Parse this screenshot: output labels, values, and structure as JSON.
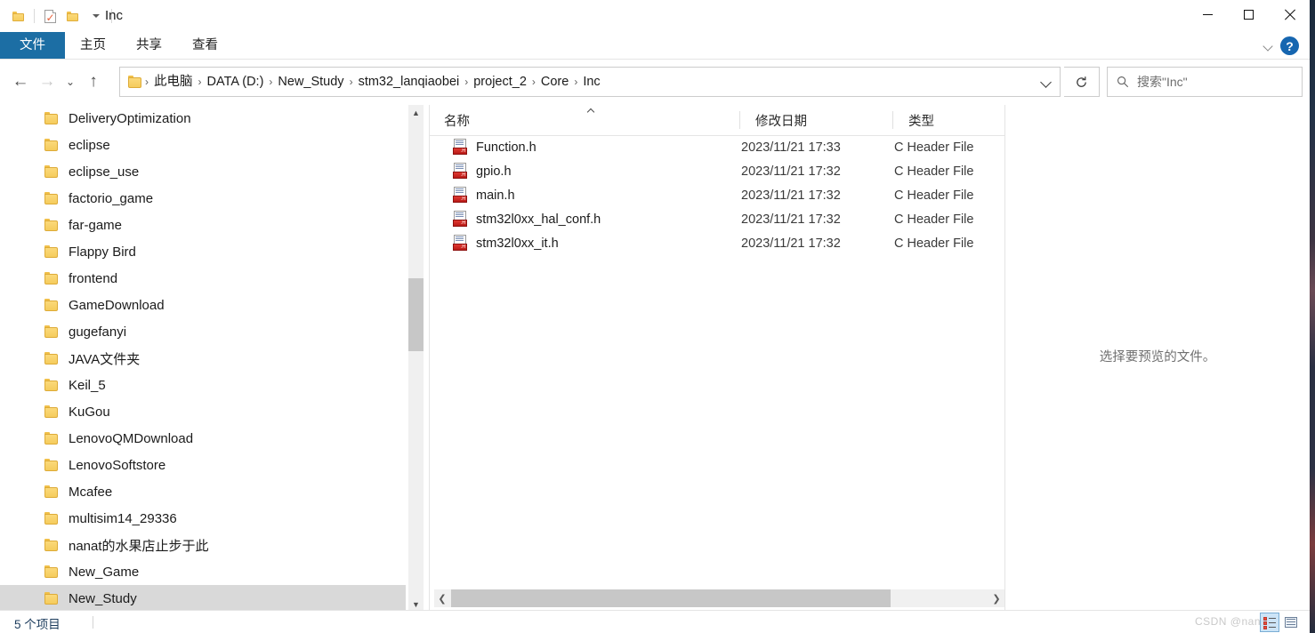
{
  "window": {
    "title": "Inc",
    "quick_access": [
      {
        "name": "folder-icon",
        "label": ""
      },
      {
        "name": "properties-icon",
        "label": ""
      },
      {
        "name": "new-folder-icon",
        "label": ""
      },
      {
        "name": "customize-dropdown-icon",
        "label": ""
      }
    ],
    "controls": {
      "minimize": "minimize-button",
      "maximize": "maximize-button",
      "close": "close-button"
    }
  },
  "ribbon": {
    "tabs": [
      {
        "label": "文件",
        "active": true
      },
      {
        "label": "主页",
        "active": false
      },
      {
        "label": "共享",
        "active": false
      },
      {
        "label": "查看",
        "active": false
      }
    ],
    "collapse_label": "",
    "help_label": "?"
  },
  "addressbar": {
    "back": "←",
    "forward": "→",
    "recent": "⌄",
    "up": "↑",
    "crumbs": [
      "此电脑",
      "DATA (D:)",
      "New_Study",
      "stm32_lanqiaobei",
      "project_2",
      "Core",
      "Inc"
    ],
    "separator": "›",
    "refresh_label": "刷新",
    "search_placeholder": "搜索\"Inc\""
  },
  "navpane": {
    "items": [
      {
        "label": "DeliveryOptimization",
        "selected": false
      },
      {
        "label": "eclipse",
        "selected": false
      },
      {
        "label": "eclipse_use",
        "selected": false
      },
      {
        "label": "factorio_game",
        "selected": false
      },
      {
        "label": "far-game",
        "selected": false
      },
      {
        "label": "Flappy Bird",
        "selected": false
      },
      {
        "label": "frontend",
        "selected": false
      },
      {
        "label": "GameDownload",
        "selected": false
      },
      {
        "label": "gugefanyi",
        "selected": false
      },
      {
        "label": "JAVA文件夹",
        "selected": false
      },
      {
        "label": "Keil_5",
        "selected": false
      },
      {
        "label": "KuGou",
        "selected": false
      },
      {
        "label": "LenovoQMDownload",
        "selected": false
      },
      {
        "label": "LenovoSoftstore",
        "selected": false
      },
      {
        "label": "Mcafee",
        "selected": false
      },
      {
        "label": "multisim14_29336",
        "selected": false
      },
      {
        "label": "nanat的水果店止步于此",
        "selected": false
      },
      {
        "label": "New_Game",
        "selected": false
      },
      {
        "label": "New_Study",
        "selected": true
      }
    ]
  },
  "filelist": {
    "columns": [
      {
        "label": "名称",
        "sorted": "asc"
      },
      {
        "label": "修改日期",
        "sorted": ""
      },
      {
        "label": "类型",
        "sorted": ""
      }
    ],
    "rows": [
      {
        "name": "Function.h",
        "date": "2023/11/21 17:33",
        "type": "C Header File"
      },
      {
        "name": "gpio.h",
        "date": "2023/11/21 17:32",
        "type": "C Header File"
      },
      {
        "name": "main.h",
        "date": "2023/11/21 17:32",
        "type": "C Header File"
      },
      {
        "name": "stm32l0xx_hal_conf.h",
        "date": "2023/11/21 17:32",
        "type": "C Header File"
      },
      {
        "name": "stm32l0xx_it.h",
        "date": "2023/11/21 17:32",
        "type": "C Header File"
      }
    ],
    "file_icon_ext": ".H"
  },
  "preview": {
    "message": "选择要预览的文件。"
  },
  "statusbar": {
    "count": "5 个项目",
    "watermark": "CSDN @nanat",
    "view_details": "details-view-button",
    "view_tiles": "tiles-view-button"
  },
  "colors": {
    "accent": "#1c6ea4",
    "selection": "#d9d9d9",
    "hover": "#e9f3fb",
    "help_blue": "#1666b0"
  }
}
